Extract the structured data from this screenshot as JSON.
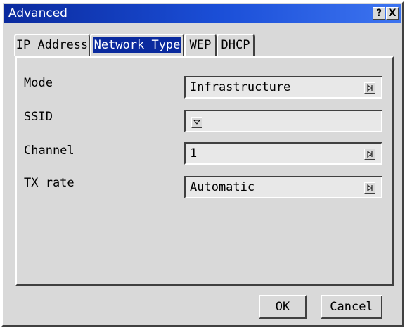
{
  "window": {
    "title": "Advanced",
    "help_label": "?",
    "close_label": "X"
  },
  "tabs": [
    {
      "label": "IP Address",
      "active": false
    },
    {
      "label": "Network Type",
      "active": true
    },
    {
      "label": "WEP",
      "active": false
    },
    {
      "label": "DHCP",
      "active": false
    }
  ],
  "form": {
    "mode": {
      "label": "Mode",
      "value": "Infrastructure"
    },
    "ssid": {
      "label": "SSID",
      "value": ""
    },
    "channel": {
      "label": "Channel",
      "value": "1"
    },
    "tx_rate": {
      "label": "TX rate",
      "value": "Automatic"
    }
  },
  "buttons": {
    "ok": "OK",
    "cancel": "Cancel"
  },
  "colors": {
    "title_bar": "#0a2a9e",
    "dialog_bg": "#d9d9d9",
    "field_bg": "#e8e8e8",
    "active_tab_highlight": "#0a2a9e"
  },
  "icons": {
    "mode_arrow": "arrow-right-icon",
    "ssid_arrow": "arrow-down-icon",
    "channel_arrow": "arrow-right-icon",
    "tx_rate_arrow": "arrow-right-icon"
  }
}
